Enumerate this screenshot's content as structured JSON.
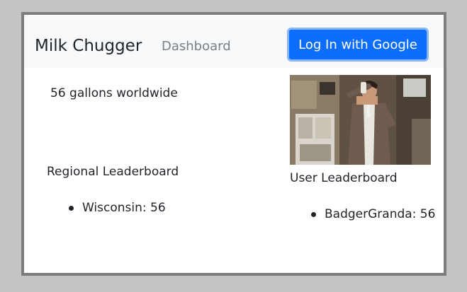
{
  "navbar": {
    "brand": "Milk Chugger",
    "dashboard_link": "Dashboard",
    "login_button": "Log In with Google"
  },
  "main": {
    "total_text": "56 gallons worldwide",
    "regional": {
      "title": "Regional Leaderboard",
      "items": [
        "Wisconsin: 56"
      ]
    },
    "user": {
      "title": "User Leaderboard",
      "items": [
        "BadgerGranda: 56"
      ]
    }
  },
  "colors": {
    "accent": "#0d6efd",
    "navbar_bg": "#f8f9fa",
    "page_bg": "#c4c4c4"
  }
}
